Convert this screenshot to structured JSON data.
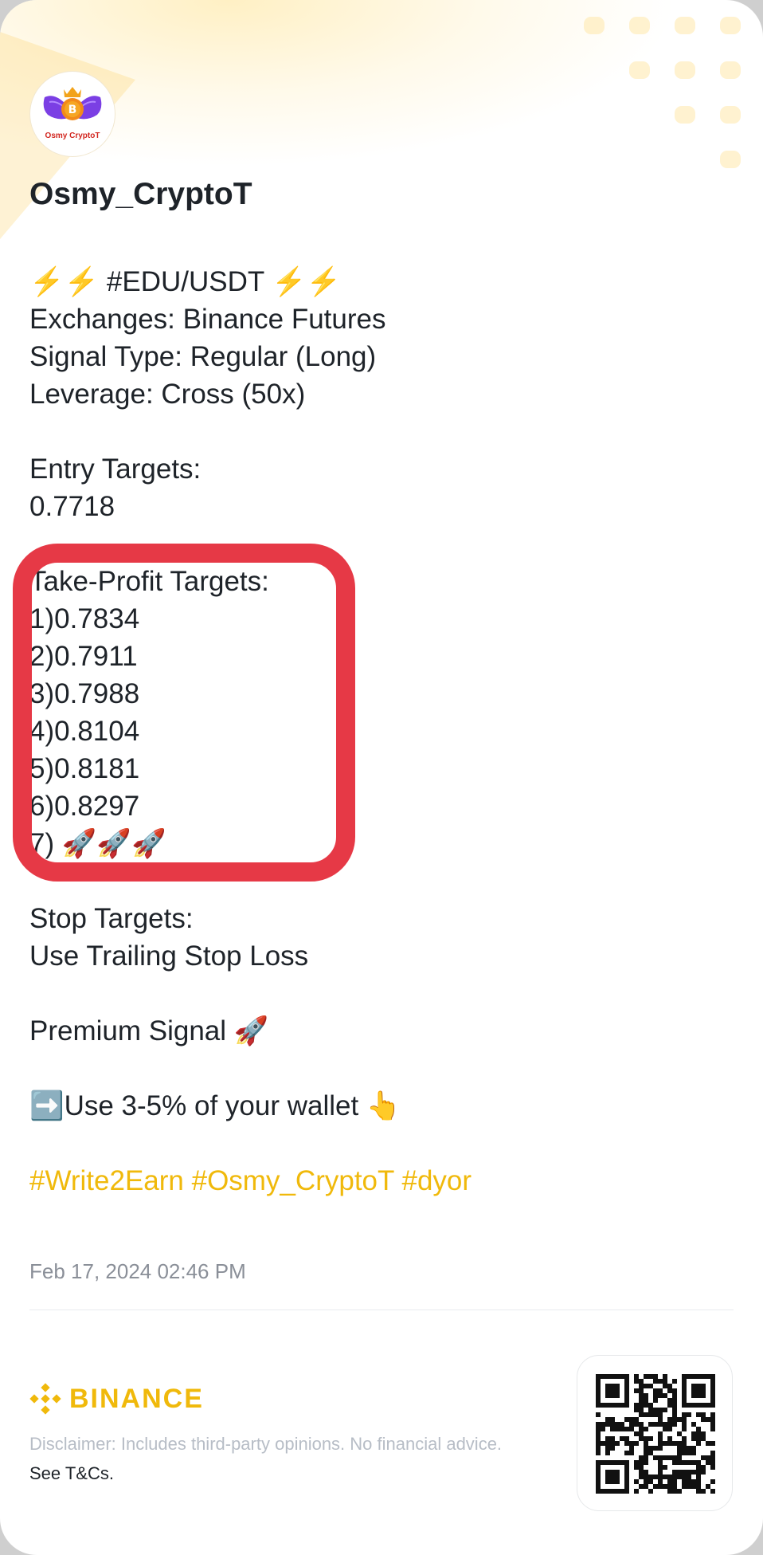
{
  "author": {
    "name": "Osmy_CryptoT",
    "avatar_text": "Osmy CryptoT"
  },
  "post": {
    "pair_line": "⚡⚡ #EDU/USDT ⚡⚡",
    "exchanges": "Exchanges: Binance Futures",
    "signal_type": "Signal Type: Regular (Long)",
    "leverage": "Leverage: Cross (50x)",
    "entry_heading": "Entry Targets:",
    "entry_value": "0.7718",
    "tp_heading": "Take-Profit Targets:",
    "tp_targets": [
      "1)0.7834",
      "2)0.7911",
      "3)0.7988",
      "4)0.8104",
      "5)0.8181",
      "6)0.8297",
      "7) 🚀🚀🚀"
    ],
    "stop_heading": "Stop Targets:",
    "stop_value": "Use Trailing Stop Loss",
    "premium": "Premium Signal 🚀",
    "wallet_note": "➡️Use 3-5% of your wallet 👆",
    "hashtags": "#Write2Earn #Osmy_CryptoT #dyor"
  },
  "timestamp": "Feb 17, 2024 02:46 PM",
  "footer": {
    "brand": "BINANCE",
    "disclaimer": "Disclaimer: Includes third-party opinions. No financial advice.",
    "terms_link": "See T&Cs."
  },
  "colors": {
    "brand_yellow": "#f0b90b",
    "highlight_red": "#e63946",
    "text_primary": "#1e2329",
    "text_muted": "#8a8f98"
  },
  "icons": [
    "avatar-logo-icon",
    "binance-logo-icon",
    "qr-code-icon"
  ]
}
